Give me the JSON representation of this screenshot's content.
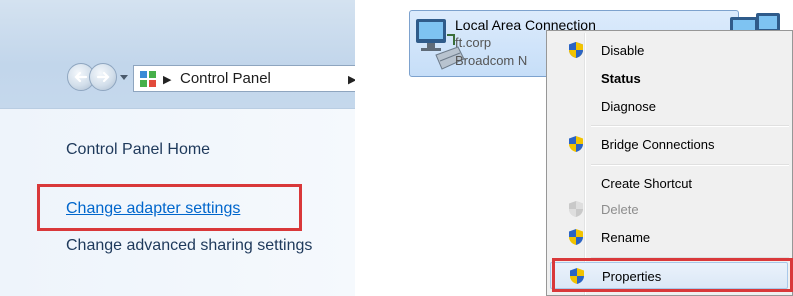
{
  "control_panel": {
    "breadcrumb": [
      "Control Panel"
    ],
    "nav_links": {
      "home": "Control Panel Home",
      "change_adapter": "Change adapter settings",
      "change_sharing": "Change advanced sharing settings"
    }
  },
  "network_connection": {
    "name": "Local Area Connection",
    "domain": "ft.corp",
    "device": "Broadcom N"
  },
  "context_menu": {
    "items": [
      {
        "label": "Disable",
        "icon": "uac-shield-icon"
      },
      {
        "label": "Status",
        "bold": true
      },
      {
        "label": "Diagnose"
      },
      {
        "label": "Bridge Connections",
        "icon": "uac-shield-icon"
      },
      {
        "label": "Create Shortcut"
      },
      {
        "label": "Delete",
        "icon": "uac-shield-icon",
        "disabled": true
      },
      {
        "label": "Rename",
        "icon": "uac-shield-icon"
      },
      {
        "label": "Properties",
        "icon": "uac-shield-icon",
        "highlighted": true
      }
    ]
  },
  "highlight_color": "#d9383a",
  "link_color": "#0066cc"
}
